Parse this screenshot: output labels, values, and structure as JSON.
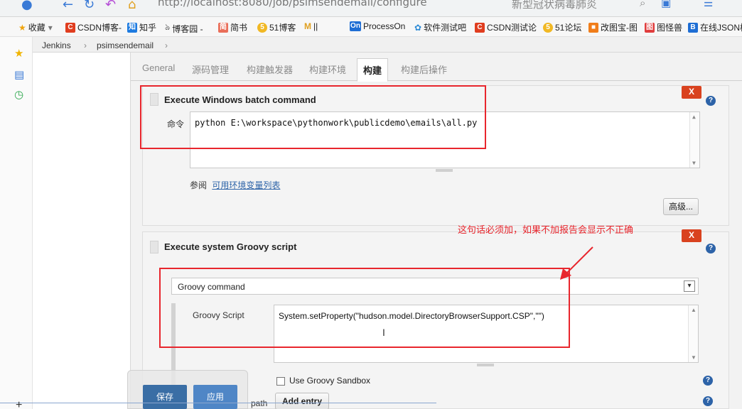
{
  "browser": {
    "url": "http://localhost:8080/job/psimsendemail/configure",
    "search_placeholder": "新型冠状病毒肺炎",
    "bookmarks": [
      {
        "label": "收藏",
        "icon": "star-icon",
        "color": "#f0a30a"
      },
      {
        "label": "CSDN博客-",
        "icon": "csdn-icon",
        "color": "#e03d1f"
      },
      {
        "label": "知乎",
        "icon": "zhihu-icon",
        "color": "#1e7be0"
      },
      {
        "label": "博客园 -",
        "icon": "cnblogs-icon",
        "color": "#555555"
      },
      {
        "label": "简书",
        "icon": "jianshu-icon",
        "color": "#ea6f5a"
      },
      {
        "label": "51博客",
        "icon": "51cto-icon",
        "color": "#f1b824"
      },
      {
        "label": "||",
        "icon": "m-icon",
        "color": "#333333"
      },
      {
        "label": "ProcessOn",
        "icon": "processon-icon",
        "color": "#1f6ed4"
      },
      {
        "label": "软件测试吧",
        "icon": "flower-icon",
        "color": "#2e8bd6"
      },
      {
        "label": "CSDN测试论",
        "icon": "csdn-icon",
        "color": "#e03d1f"
      },
      {
        "label": "51论坛",
        "icon": "51-icon",
        "color": "#f1b824"
      },
      {
        "label": "改图宝-图",
        "icon": "gaitubao-icon",
        "color": "#f07d1a"
      },
      {
        "label": "图怪兽",
        "icon": "tuguaishou-icon",
        "color": "#e03d3d"
      },
      {
        "label": "在线JSON校",
        "icon": "json-icon",
        "color": "#1f6ed4"
      }
    ]
  },
  "breadcrumb": {
    "root": "Jenkins",
    "sep": "›",
    "job": "psimsendemail",
    "sep2": "›"
  },
  "tabs": [
    {
      "label": "General",
      "active": false
    },
    {
      "label": "源码管理",
      "active": false
    },
    {
      "label": "构建触发器",
      "active": false
    },
    {
      "label": "构建环境",
      "active": false
    },
    {
      "label": "构建",
      "active": true
    },
    {
      "label": "构建后操作",
      "active": false
    }
  ],
  "batch_step": {
    "title": "Execute Windows batch command",
    "command_label": "命令",
    "command": "python E:\\workspace\\pythonwork\\publicdemo\\emails\\all.py",
    "see_also_prefix": "参阅",
    "see_also_link": "可用环境变量列表",
    "advanced_button": "高级...",
    "delete_label": "X",
    "help_label": "?"
  },
  "groovy_step": {
    "title": "Execute system Groovy script",
    "delete_label": "X",
    "help_label": "?",
    "source_select": "Groovy command",
    "script_label": "Groovy Script",
    "script": "System.setProperty(\"hudson.model.DirectoryBrowserSupport.CSP\",\"\")",
    "sandbox_label": "Use Groovy Sandbox",
    "classpath_label": "path",
    "add_entry_button": "Add entry"
  },
  "annotation": {
    "note": "这句话必须加，如果不加报告会显示不正确",
    "color": "#e8262d"
  },
  "savebar": {
    "save_label": "保存",
    "apply_label": "应用",
    "save_color": "#3a6ea5",
    "apply_color": "#4f86c6"
  }
}
